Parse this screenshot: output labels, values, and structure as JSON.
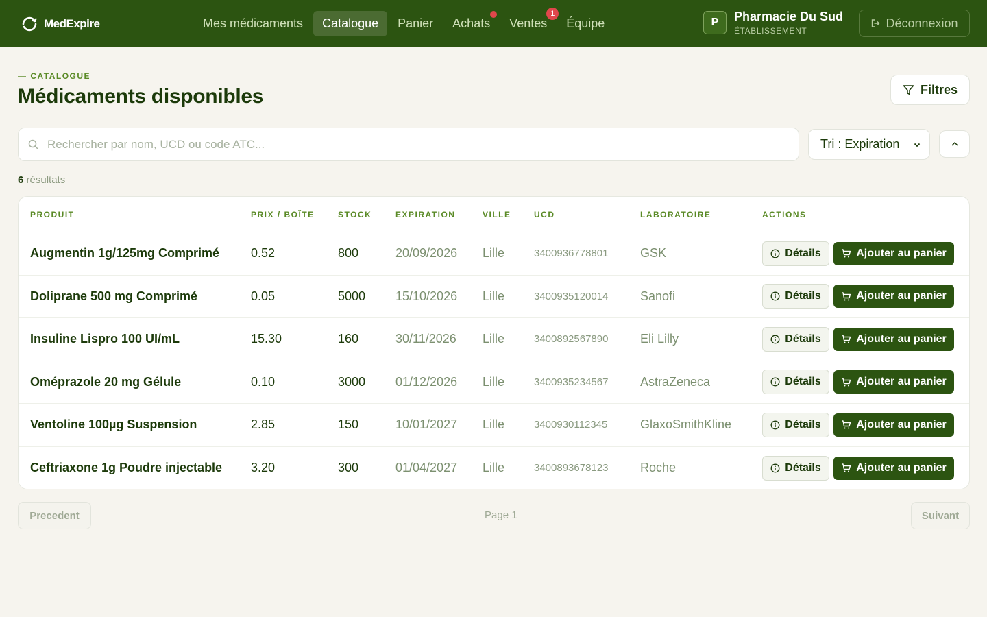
{
  "header": {
    "brand": "MedExpire",
    "nav": [
      {
        "label": "Mes médicaments",
        "active": false
      },
      {
        "label": "Catalogue",
        "active": true
      },
      {
        "label": "Panier",
        "active": false
      },
      {
        "label": "Achats",
        "active": false,
        "dot": true
      },
      {
        "label": "Ventes",
        "active": false,
        "badge": "1"
      },
      {
        "label": "Équipe",
        "active": false
      }
    ],
    "user": {
      "initial": "P",
      "name": "Pharmacie Du Sud",
      "role": "ÉTABLISSEMENT"
    },
    "logout_label": "Déconnexion"
  },
  "page": {
    "eyebrow": "— CATALOGUE",
    "title": "Médicaments disponibles",
    "filters_label": "Filtres"
  },
  "search": {
    "placeholder": "Rechercher par nom, UCD ou code ATC...",
    "value": ""
  },
  "sort": {
    "label": "Tri : Expiration"
  },
  "results": {
    "count": "6",
    "label": "résultats"
  },
  "table": {
    "headers": [
      "PRODUIT",
      "PRIX / BOÎTE",
      "STOCK",
      "EXPIRATION",
      "VILLE",
      "UCD",
      "LABORATOIRE",
      "ACTIONS"
    ],
    "details_label": "Détails",
    "cart_label": "Ajouter au panier",
    "rows": [
      {
        "product": "Augmentin 1g/125mg Comprimé",
        "price": "0.52",
        "stock": "800",
        "expiration": "20/09/2026",
        "city": "Lille",
        "ucd": "3400936778801",
        "lab": "GSK"
      },
      {
        "product": "Doliprane 500 mg Comprimé",
        "price": "0.05",
        "stock": "5000",
        "expiration": "15/10/2026",
        "city": "Lille",
        "ucd": "3400935120014",
        "lab": "Sanofi"
      },
      {
        "product": "Insuline Lispro 100 UI/mL",
        "price": "15.30",
        "stock": "160",
        "expiration": "30/11/2026",
        "city": "Lille",
        "ucd": "3400892567890",
        "lab": "Eli Lilly"
      },
      {
        "product": "Oméprazole 20 mg Gélule",
        "price": "0.10",
        "stock": "3000",
        "expiration": "01/12/2026",
        "city": "Lille",
        "ucd": "3400935234567",
        "lab": "AstraZeneca"
      },
      {
        "product": "Ventoline 100µg Suspension",
        "price": "2.85",
        "stock": "150",
        "expiration": "10/01/2027",
        "city": "Lille",
        "ucd": "3400930112345",
        "lab": "GlaxoSmithKline"
      },
      {
        "product": "Ceftriaxone 1g Poudre injectable",
        "price": "3.20",
        "stock": "300",
        "expiration": "01/04/2027",
        "city": "Lille",
        "ucd": "3400893678123",
        "lab": "Roche"
      }
    ]
  },
  "pagination": {
    "prev_label": "Precedent",
    "page_label": "Page 1",
    "next_label": "Suivant"
  },
  "colors": {
    "primary": "#2c5411",
    "accent": "#5a8a26",
    "badge": "#e0474c",
    "background": "#f6f4ee"
  }
}
